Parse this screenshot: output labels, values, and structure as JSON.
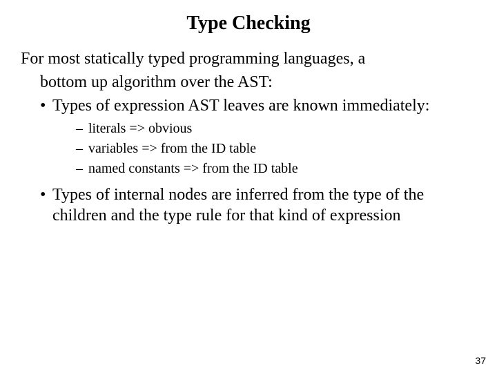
{
  "title": "Type Checking",
  "intro_line1": "For most statically typed programming languages, a",
  "intro_line2": "bottom up algorithm over the AST:",
  "bullets": [
    {
      "text": "Types of expression AST  leaves are known immediately:",
      "sub": [
        "literals => obvious",
        "variables => from the ID table",
        "named constants => from the ID table"
      ]
    },
    {
      "text": "Types of internal nodes are inferred from the type of the children and the type rule for that kind of expression",
      "sub": []
    }
  ],
  "page_number": "37"
}
